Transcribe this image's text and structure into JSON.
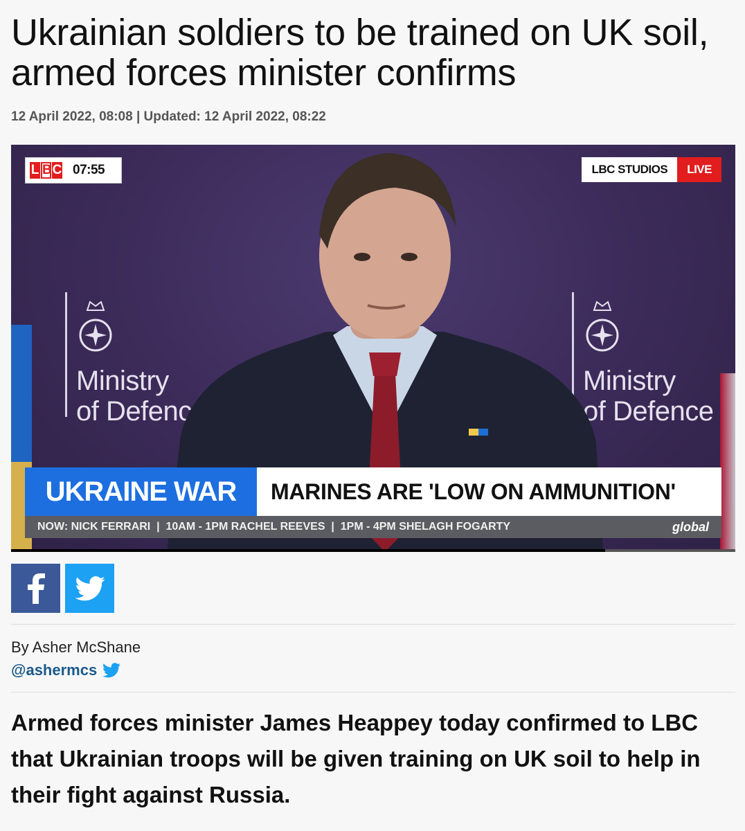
{
  "article": {
    "headline": "Ukrainian soldiers to be trained on UK soil, armed forces minister confirms",
    "dateline": "12 April 2022, 08:08 | Updated: 12 April 2022, 08:22",
    "author": "By Asher McShane",
    "author_handle": "@ashermcs",
    "standfirst": "Armed forces minister James Heappey today confirmed to LBC that Ukrainian troops will be given training on UK soil to help in their fight against Russia."
  },
  "video": {
    "logo_letters": [
      "L",
      "B",
      "C"
    ],
    "clock": "07:55",
    "studio_label": "LBC STUDIOS",
    "live_label": "LIVE",
    "backdrop_left": "Ministry\nof Defenc",
    "backdrop_right": "Ministry\nof Defence",
    "banner_tag": "UKRAINE WAR",
    "banner_headline": "MARINES ARE 'LOW ON AMMUNITION'",
    "ticker": "NOW: NICK FERRARI  |  10AM - 1PM RACHEL REEVES  |  1PM - 4PM SHELAGH FOGARTY",
    "network_logo": "global",
    "progress_fraction": 0.82
  },
  "share": {
    "facebook_icon": "facebook-icon",
    "twitter_icon": "twitter-icon"
  },
  "colors": {
    "lbc_red": "#e11d1d",
    "banner_blue": "#1d6fe0",
    "facebook": "#3b5998",
    "twitter": "#1da1f2",
    "handle_link": "#1a5a8a"
  }
}
